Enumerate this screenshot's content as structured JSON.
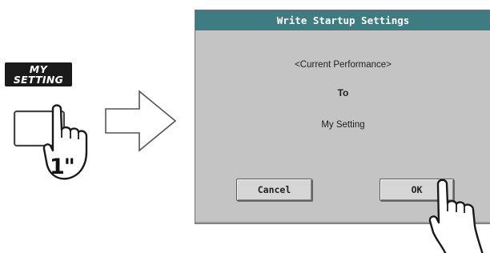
{
  "badge": {
    "line1": "MY",
    "line2": "SETTING"
  },
  "press": {
    "label": "1\""
  },
  "dialog": {
    "title": "Write Startup Settings",
    "source": "<Current Performance>",
    "to_label": "To",
    "destination": "My Setting",
    "cancel_label": "Cancel",
    "ok_label": "OK"
  },
  "icons": {
    "arrow": "right-arrow-icon",
    "hand_key": "pointing-hand-icon",
    "hand_ok": "pointing-hand-icon"
  },
  "colors": {
    "title_bar": "#3e7c81",
    "dialog_bg": "#c4c4c4",
    "badge_bg": "#1a1a1a"
  }
}
